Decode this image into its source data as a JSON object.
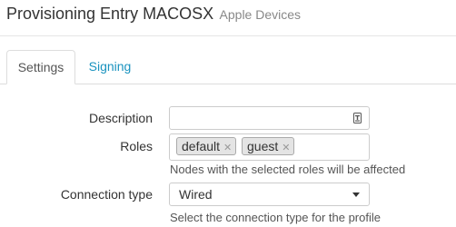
{
  "header": {
    "title": "Provisioning Entry MACOSX",
    "subtitle": "Apple Devices"
  },
  "tabs": [
    {
      "label": "Settings",
      "active": true
    },
    {
      "label": "Signing",
      "active": false
    }
  ],
  "form": {
    "description": {
      "label": "Description",
      "value": "",
      "icon": "text-input-icon"
    },
    "roles": {
      "label": "Roles",
      "tags": [
        "default",
        "guest"
      ],
      "remove_symbol": "✕",
      "help": "Nodes with the selected roles will be affected"
    },
    "connection_type": {
      "label": "Connection type",
      "value": "Wired",
      "help": "Select the connection type for the profile"
    }
  },
  "colors": {
    "link": "#1a93bf",
    "border": "#cccccc",
    "tag_bg": "#e4e4e4"
  }
}
